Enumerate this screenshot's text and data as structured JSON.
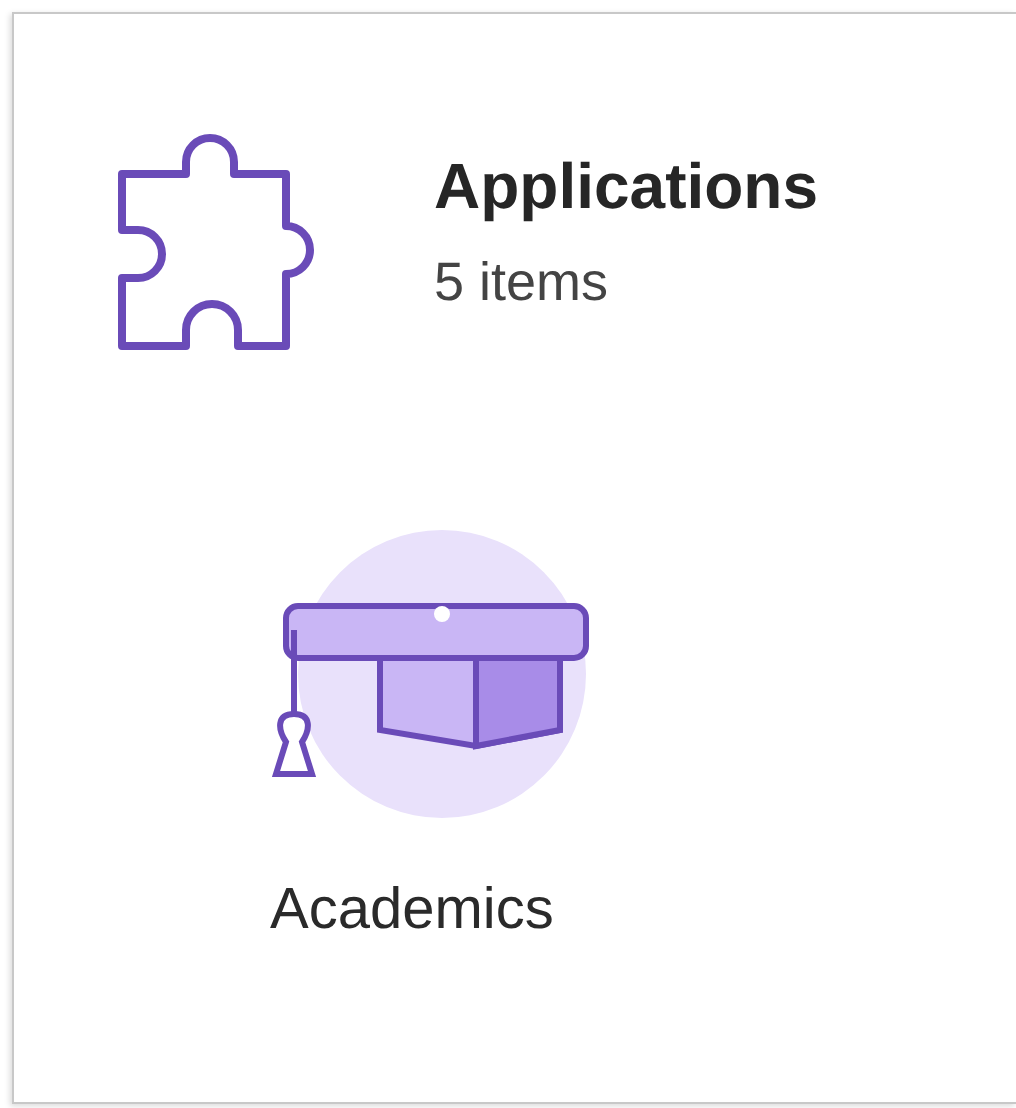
{
  "header": {
    "title": "Applications",
    "count": "5 items"
  },
  "apps": [
    {
      "label": "Academics"
    }
  ]
}
